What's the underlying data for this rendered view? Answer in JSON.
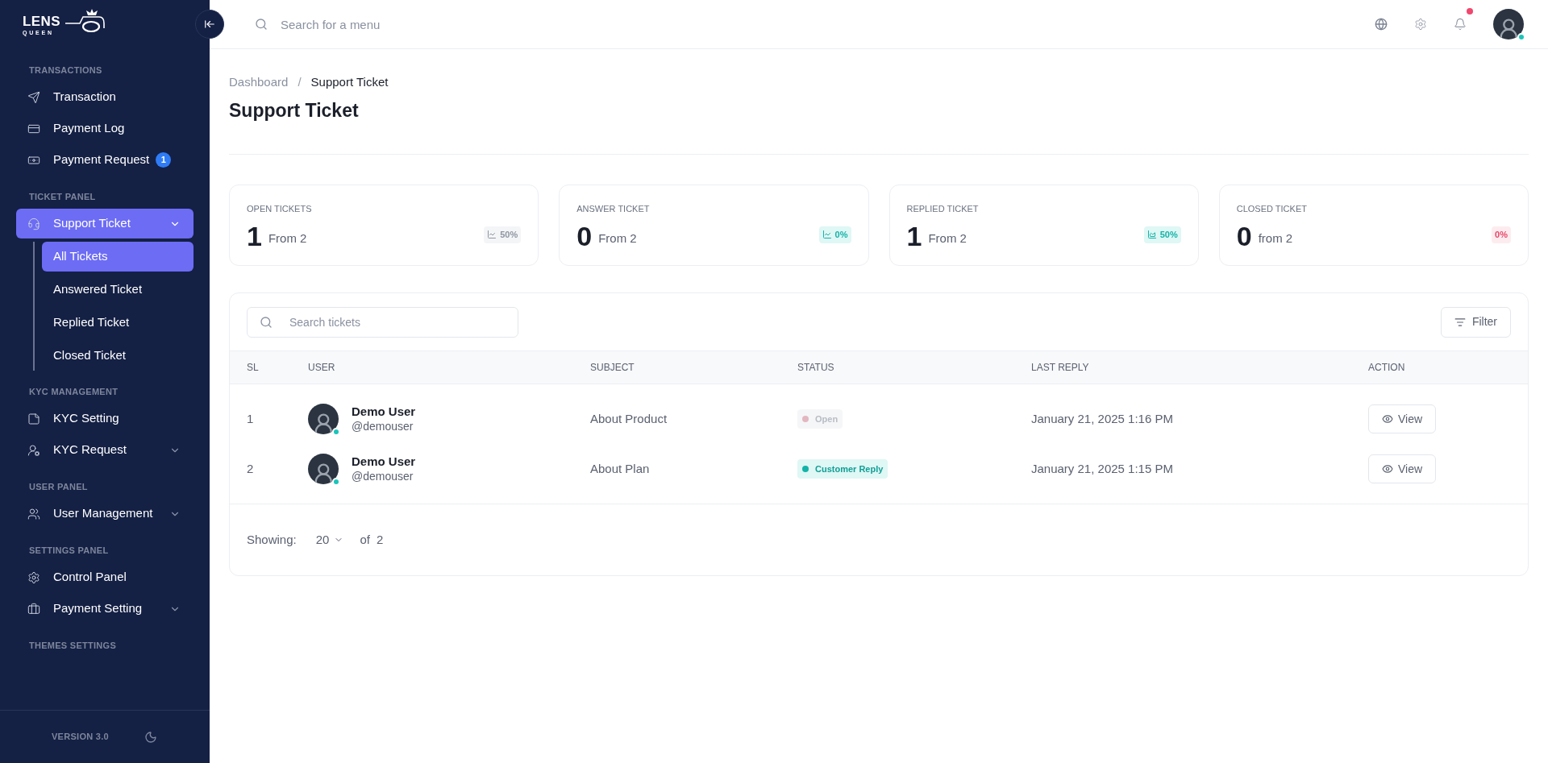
{
  "logo": {
    "title": "LENS",
    "subtitle": "QUEEN"
  },
  "sidebar": {
    "sections": [
      {
        "heading": "TRANSACTIONS",
        "items": [
          {
            "label": "Transaction",
            "selected": false
          },
          {
            "label": "Payment Log",
            "selected": false
          },
          {
            "label": "Payment Request",
            "selected": false,
            "badge": "1"
          }
        ]
      },
      {
        "heading": "TICKET PANEL",
        "items": [
          {
            "label": "Support Ticket",
            "selected": true,
            "expanded": true,
            "children": [
              {
                "label": "All Tickets",
                "selected": true
              },
              {
                "label": "Answered Ticket",
                "selected": false
              },
              {
                "label": "Replied Ticket",
                "selected": false
              },
              {
                "label": "Closed Ticket",
                "selected": false
              }
            ]
          }
        ]
      },
      {
        "heading": "KYC MANAGEMENT",
        "items": [
          {
            "label": "KYC Setting",
            "selected": false
          },
          {
            "label": "KYC Request",
            "selected": false,
            "expanded": false
          }
        ]
      },
      {
        "heading": "USER PANEL",
        "items": [
          {
            "label": "User Management",
            "selected": false,
            "expanded": false
          }
        ]
      },
      {
        "heading": "SETTINGS PANEL",
        "items": [
          {
            "label": "Control Panel",
            "selected": false
          },
          {
            "label": "Payment Setting",
            "selected": false,
            "expanded": false
          }
        ]
      },
      {
        "heading": "THEMES SETTINGS"
      }
    ],
    "version": "VERSION 3.0"
  },
  "topbar": {
    "search": {
      "placeholder": "Search for a menu"
    },
    "notification_unread": true,
    "user_online": true
  },
  "breadcrumb_separator": "/",
  "breadcrumb": [
    {
      "label": "Dashboard",
      "selected": false
    },
    {
      "label": "Support Ticket",
      "selected": true
    }
  ],
  "page_title": "Support Ticket",
  "stats": [
    {
      "label": "OPEN TICKETS",
      "value": "1",
      "sub": "From 2",
      "change": "50%",
      "kind": "neutral"
    },
    {
      "label": "ANSWER TICKET",
      "value": "0",
      "sub": "From 2",
      "change": "0%",
      "kind": "up"
    },
    {
      "label": "REPLIED TICKET",
      "value": "1",
      "sub": "From 2",
      "change": "50%",
      "kind": "area"
    },
    {
      "label": "CLOSED TICKET",
      "value": "0",
      "sub": "from 2",
      "change": "0%",
      "kind": "down"
    }
  ],
  "table": {
    "search": {
      "placeholder": "Search tickets"
    },
    "filter": "Filter",
    "columns": [
      "SL",
      "USER",
      "SUBJECT",
      "STATUS",
      "LAST REPLY",
      "ACTION"
    ],
    "rows": [
      {
        "sl": "1",
        "name": "Demo User",
        "username": "@demouser",
        "online": true,
        "subject": "About Product",
        "status": {
          "label": "Open",
          "kind": "open"
        },
        "last_reply": "January 21, 2025 1:16 PM",
        "action": "View"
      },
      {
        "sl": "2",
        "name": "Demo User",
        "username": "@demouser",
        "online": true,
        "subject": "About Plan",
        "status": {
          "label": "Customer Reply",
          "kind": "reply"
        },
        "last_reply": "January 21, 2025 1:15 PM",
        "action": "View"
      }
    ],
    "footer": {
      "label": "Showing:",
      "per_page": "20",
      "of": "of",
      "total": "2"
    }
  }
}
